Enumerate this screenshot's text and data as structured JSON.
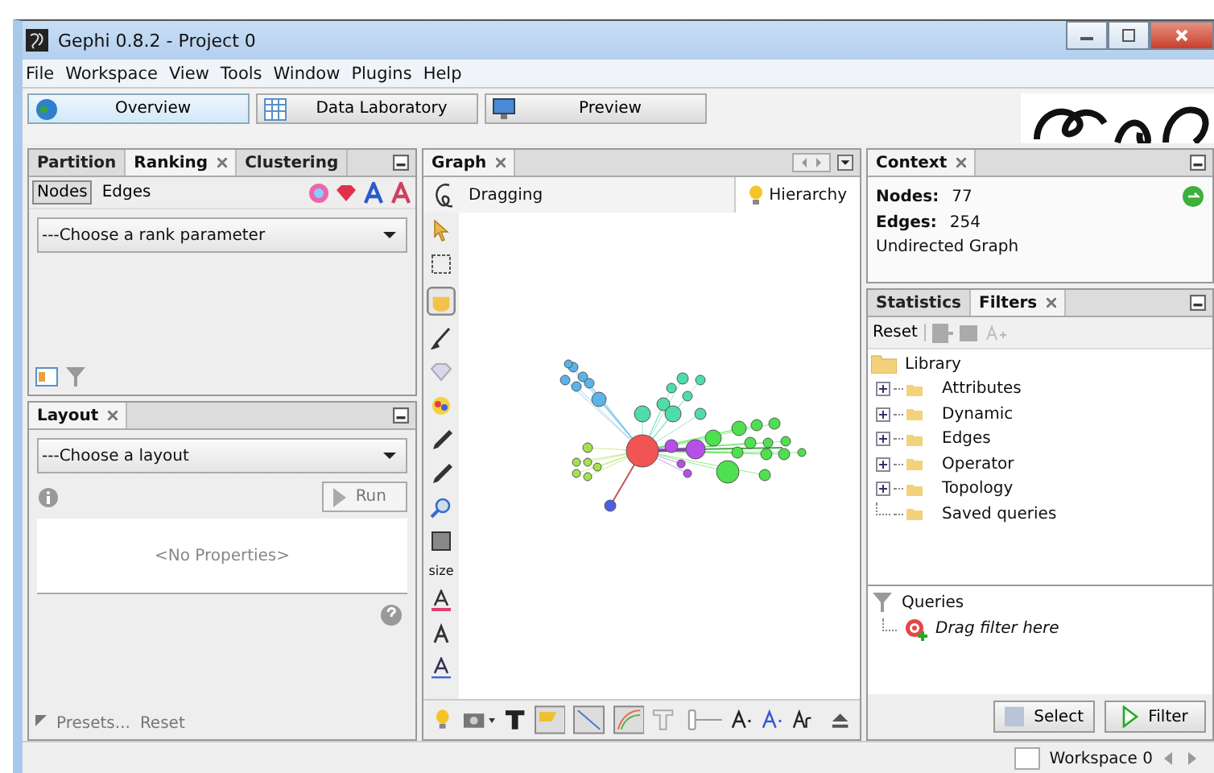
{
  "window": {
    "title": "Gephi 0.8.2 - Project 0"
  },
  "menu": [
    "File",
    "Workspace",
    "View",
    "Tools",
    "Window",
    "Plugins",
    "Help"
  ],
  "perspectives": [
    {
      "label": "Overview",
      "selected": true,
      "kind": "globe"
    },
    {
      "label": "Data Laboratory",
      "selected": false,
      "kind": "table"
    },
    {
      "label": "Preview",
      "selected": false,
      "kind": "monitor"
    }
  ],
  "ranking_panel": {
    "tabs": [
      {
        "label": "Partition",
        "selected": false
      },
      {
        "label": "Ranking",
        "selected": true
      },
      {
        "label": "Clustering",
        "selected": false
      }
    ],
    "element_tabs": [
      {
        "label": "Nodes",
        "selected": true
      },
      {
        "label": "Edges",
        "selected": false
      }
    ],
    "dropdown": {
      "value": "---Choose a rank parameter"
    }
  },
  "layout_panel": {
    "tab": "Layout",
    "dropdown": {
      "value": "---Choose a layout"
    },
    "run_button": "Run",
    "properties": "<No Properties>",
    "presets": "Presets...",
    "reset": "Reset"
  },
  "graph_panel": {
    "tab": "Graph",
    "mode": "Dragging",
    "hierarchy": "Hierarchy",
    "size_tool": "size"
  },
  "context_panel": {
    "tab": "Context",
    "nodes_label": "Nodes:",
    "nodes": "77",
    "edges_label": "Edges:",
    "edges": "254",
    "graph_type": "Undirected Graph"
  },
  "filters_panel": {
    "tabs": [
      {
        "label": "Statistics",
        "selected": false
      },
      {
        "label": "Filters",
        "selected": true
      }
    ],
    "reset": "Reset",
    "library": {
      "label": "Library",
      "children": [
        {
          "label": "Attributes",
          "kind": "group"
        },
        {
          "label": "Dynamic",
          "kind": "group"
        },
        {
          "label": "Edges",
          "kind": "group"
        },
        {
          "label": "Operator",
          "kind": "group"
        },
        {
          "label": "Topology",
          "kind": "group"
        },
        {
          "label": "Saved queries",
          "kind": "leaf"
        }
      ]
    },
    "queries": {
      "label": "Queries",
      "children": [
        {
          "label": "Drag filter here"
        }
      ]
    },
    "buttons": [
      {
        "label": "Select",
        "kind": "select"
      },
      {
        "label": "Filter",
        "kind": "filter"
      }
    ]
  },
  "status_bar": {
    "workspace": "Workspace 0"
  }
}
